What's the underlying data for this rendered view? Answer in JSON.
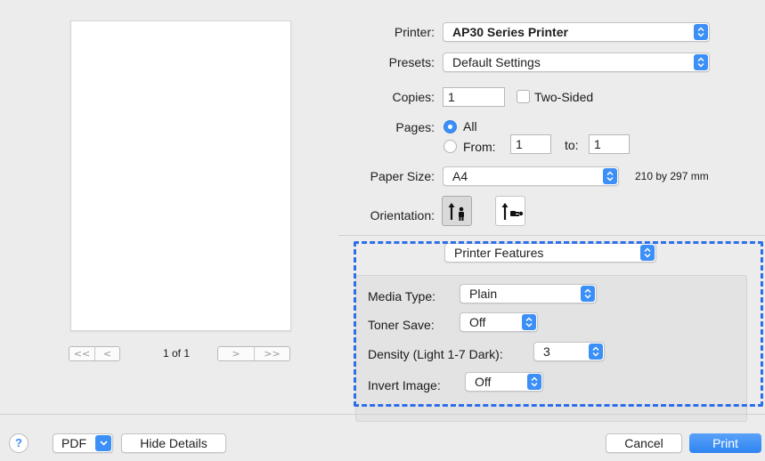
{
  "preview": {
    "page_counter": "1 of 1",
    "nav_first": "<<",
    "nav_prev": "<",
    "nav_next": ">",
    "nav_last": ">>"
  },
  "printer": {
    "label": "Printer:",
    "value": "AP30 Series Printer"
  },
  "presets": {
    "label": "Presets:",
    "value": "Default Settings"
  },
  "copies": {
    "label": "Copies:",
    "value": "1",
    "two_sided_label": "Two-Sided"
  },
  "pages": {
    "label": "Pages:",
    "all_label": "All",
    "from_label": "From:",
    "from_value": "1",
    "to_label": "to:",
    "to_value": "1"
  },
  "paper_size": {
    "label": "Paper Size:",
    "value": "A4",
    "dimensions": "210 by 297 mm"
  },
  "orientation": {
    "label": "Orientation:"
  },
  "features": {
    "section": "Printer Features",
    "media_type": {
      "label": "Media Type:",
      "value": "Plain"
    },
    "toner_save": {
      "label": "Toner Save:",
      "value": "Off"
    },
    "density": {
      "label": "Density (Light 1-7 Dark):",
      "value": "3"
    },
    "invert_image": {
      "label": "Invert Image:",
      "value": "Off"
    }
  },
  "footer": {
    "help": "?",
    "pdf": "PDF",
    "hide_details": "Hide Details",
    "cancel": "Cancel",
    "print": "Print"
  },
  "colors": {
    "accent": "#3c8ff7",
    "highlight_dash": "#2e6fe8"
  }
}
